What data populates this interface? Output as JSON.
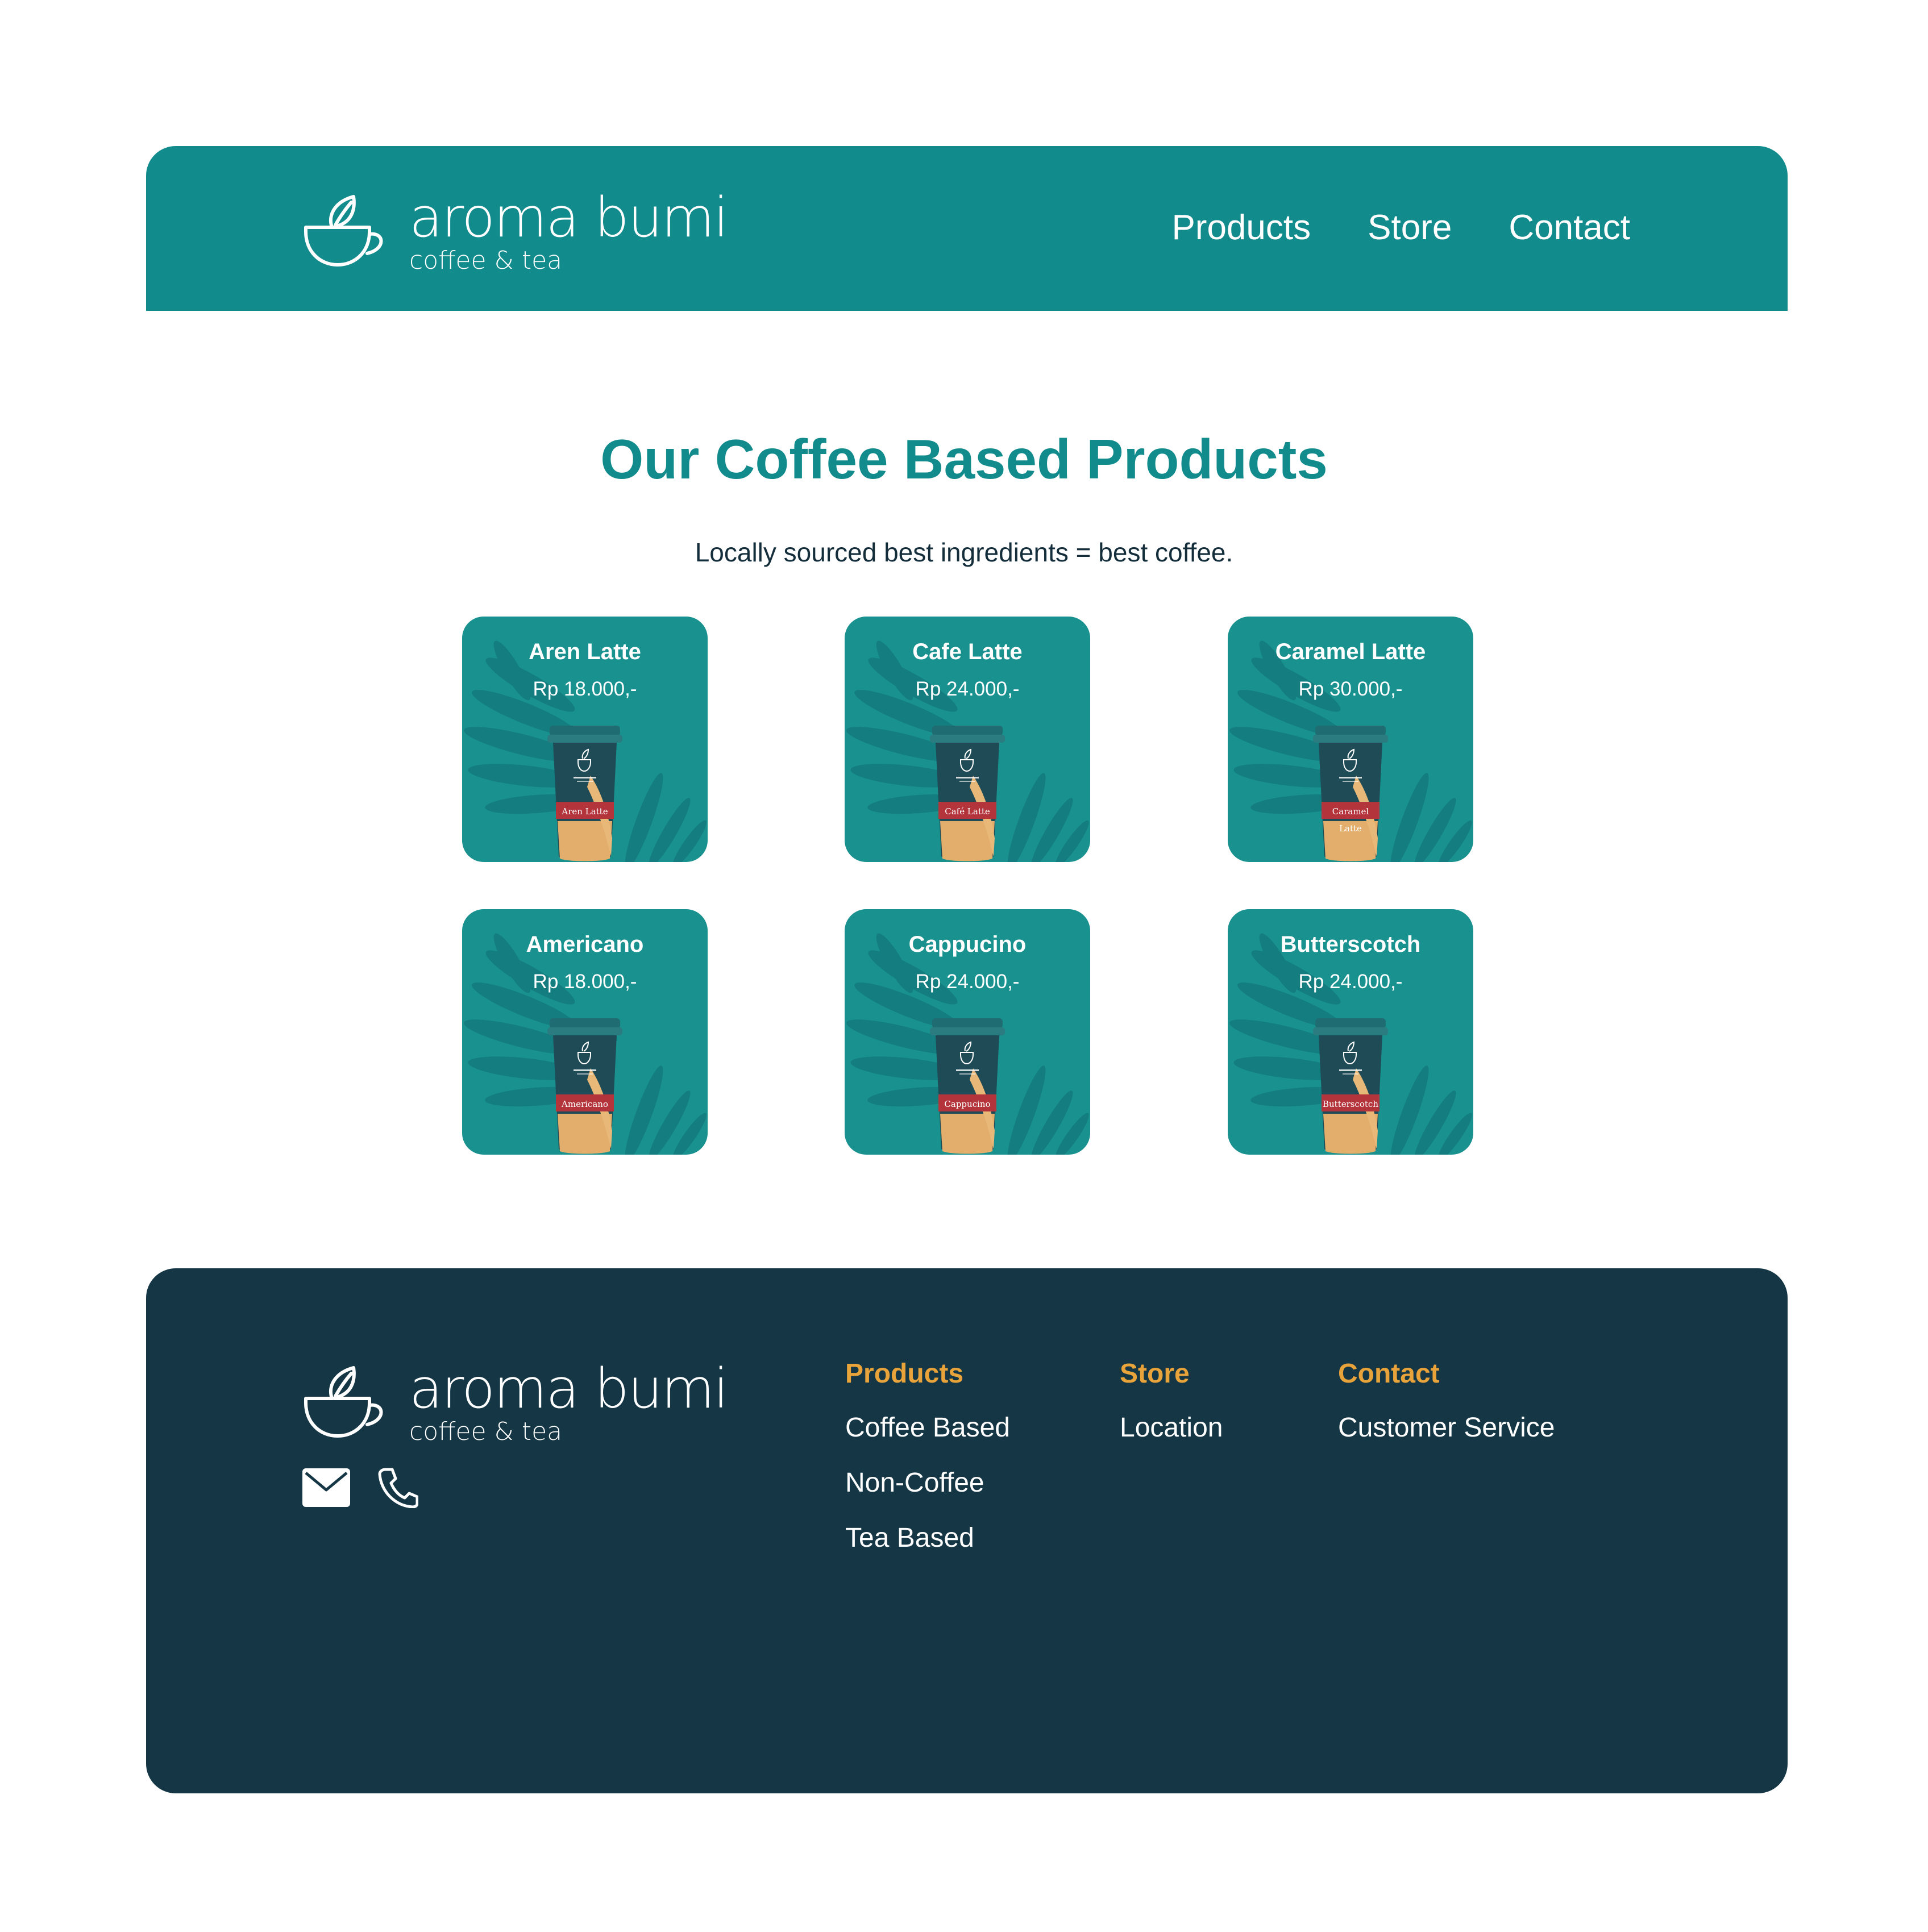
{
  "colors": {
    "teal": "#128b8c",
    "card_teal": "#19918f",
    "footer_navy": "#153644",
    "accent_orange": "#e8a33a"
  },
  "brand": {
    "name": "aroma bumi",
    "tagline": "coffee & tea",
    "logo_icon": "cup-with-leaf-icon"
  },
  "nav": {
    "items": [
      "Products",
      "Store",
      "Contact"
    ]
  },
  "main": {
    "title": "Our Coffee Based Products",
    "subtitle": "Locally sourced best ingredients = best coffee."
  },
  "products": [
    {
      "name": "Aren Latte",
      "price": "Rp 18.000,-",
      "cup_label": "Aren Latte"
    },
    {
      "name": "Cafe  Latte",
      "price": "Rp 24.000,-",
      "cup_label": "Café Latte"
    },
    {
      "name": "Caramel  Latte",
      "price": "Rp 30.000,-",
      "cup_label": "Caramel Latte"
    },
    {
      "name": "Americano",
      "price": "Rp 18.000,-",
      "cup_label": "Americano"
    },
    {
      "name": "Cappucino",
      "price": "Rp 24.000,-",
      "cup_label": "Cappucino"
    },
    {
      "name": "Butterscotch",
      "price": "Rp 24.000,-",
      "cup_label": "Butterscotch"
    }
  ],
  "footer": {
    "icons": [
      "mail-icon",
      "phone-icon"
    ],
    "columns": [
      {
        "heading": "Products",
        "links": [
          "Coffee Based",
          "Non-Coffee",
          "Tea Based"
        ]
      },
      {
        "heading": "Store",
        "links": [
          "Location"
        ]
      },
      {
        "heading": "Contact",
        "links": [
          "Customer Service"
        ]
      }
    ]
  }
}
